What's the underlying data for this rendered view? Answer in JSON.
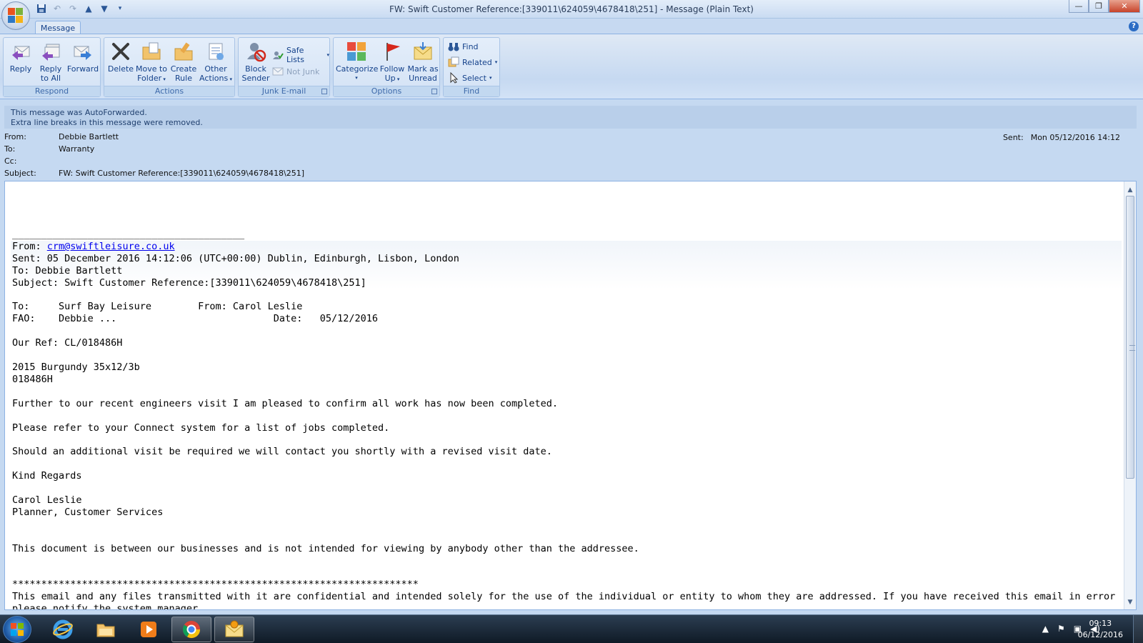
{
  "window": {
    "title": "FW: Swift Customer Reference:[339011\\624059\\4678418\\251] - Message (Plain Text)",
    "minimize": "—",
    "maximize": "❐",
    "close": "✕"
  },
  "ribbon": {
    "tab": "Message",
    "help": "?",
    "groups": {
      "respond": {
        "label": "Respond",
        "reply": "Reply",
        "reply_all_1": "Reply",
        "reply_all_2": "to All",
        "forward": "Forward"
      },
      "actions": {
        "label": "Actions",
        "delete": "Delete",
        "move_1": "Move to",
        "move_2": "Folder",
        "create_rule_1": "Create",
        "create_rule_2": "Rule",
        "other_1": "Other",
        "other_2": "Actions"
      },
      "junk": {
        "label": "Junk E-mail",
        "block_1": "Block",
        "block_2": "Sender",
        "safe_lists": "Safe Lists",
        "not_junk": "Not Junk"
      },
      "options": {
        "label": "Options",
        "categorize": "Categorize",
        "follow_1": "Follow",
        "follow_2": "Up",
        "mark_1": "Mark as",
        "mark_2": "Unread"
      },
      "find": {
        "label": "Find",
        "find": "Find",
        "related": "Related",
        "select": "Select"
      }
    }
  },
  "infobar": {
    "line1": "This message was AutoForwarded.",
    "line2": "Extra line breaks in this message were removed."
  },
  "header": {
    "from_label": "From:",
    "from": "Debbie Bartlett",
    "to_label": "To:",
    "to": "Warranty",
    "cc_label": "Cc:",
    "cc": "",
    "subject_label": "Subject:",
    "subject": "FW: Swift Customer Reference:[339011\\624059\\4678418\\251]",
    "sent_label": "Sent:",
    "sent": "Mon 05/12/2016 14:12"
  },
  "body": {
    "separator": "________________________________________",
    "fwd_from_label": "From: ",
    "fwd_from": "crm@swiftleisure.co.uk",
    "fwd_sent": "Sent: 05 December 2016 14:12:06 (UTC+00:00) Dublin, Edinburgh, Lisbon, London",
    "fwd_to": "To: Debbie Bartlett",
    "fwd_subject": "Subject: Swift Customer Reference:[339011\\624059\\4678418\\251]",
    "to_line": "To:     Surf Bay Leisure        From: Carol Leslie",
    "fao_line": "FAO:    Debbie ...                           Date:   05/12/2016",
    "ref_line": "Our Ref: CL/018486H",
    "model_line": "2015 Burgundy 35x12/3b",
    "serial_line": "018486H",
    "para1": "Further to our recent engineers visit I am pleased to confirm all work has now been completed.",
    "para2": "Please refer to your Connect system for a list of jobs completed.",
    "para3": "Should an additional visit be required we will contact you shortly with a revised visit date.",
    "regards": "Kind Regards",
    "sig_name": "Carol Leslie",
    "sig_title": "Planner, Customer Services",
    "notice": "This document is between our businesses and is not intended for viewing by anybody other than the addressee.",
    "stars": "**********************************************************************",
    "disclaimer": "This email and any files transmitted with it are confidential and intended solely for the use of the individual or entity to whom they are addressed. If you have received this email in error",
    "disclaimer2": "please notify the system manager."
  },
  "taskbar": {
    "time": "09:13",
    "date": "06/12/2016"
  }
}
